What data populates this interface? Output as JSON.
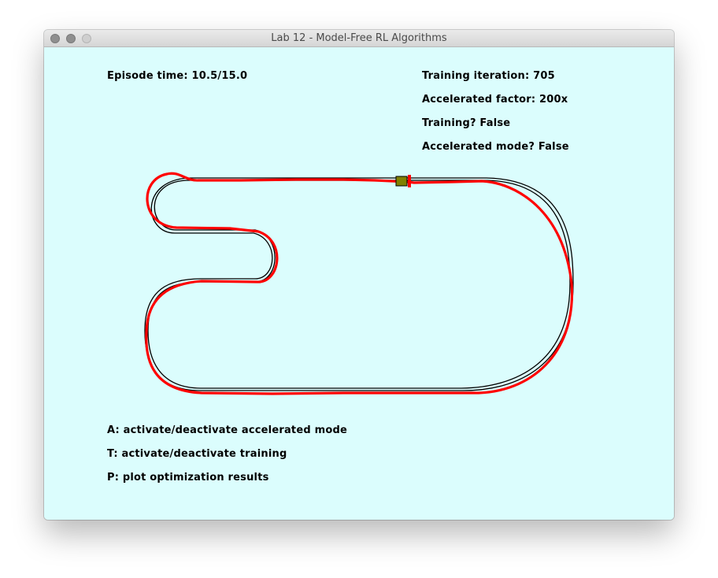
{
  "window": {
    "title": "Lab 12 - Model-Free RL Algorithms"
  },
  "hud": {
    "episode_time": "Episode time: 10.5/15.0",
    "training_iteration": "Training iteration: 705",
    "accelerated_factor": "Accelerated factor: 200x",
    "training_status": "Training? False",
    "accelerated_mode_status": "Accelerated mode? False"
  },
  "controls": {
    "accelerated_mode_key": "A: activate/deactivate accelerated mode",
    "training_key": "T: activate/deactivate training",
    "plot_key": "P: plot optimization results"
  },
  "colors": {
    "background": "#dbfdfd",
    "track_line": "#000000",
    "trajectory": "#ff0000",
    "car": "#808000"
  },
  "icons": {
    "close": "traffic-light-close-icon",
    "minimize": "traffic-light-minimize-icon",
    "maximize": "traffic-light-maximize-icon"
  }
}
